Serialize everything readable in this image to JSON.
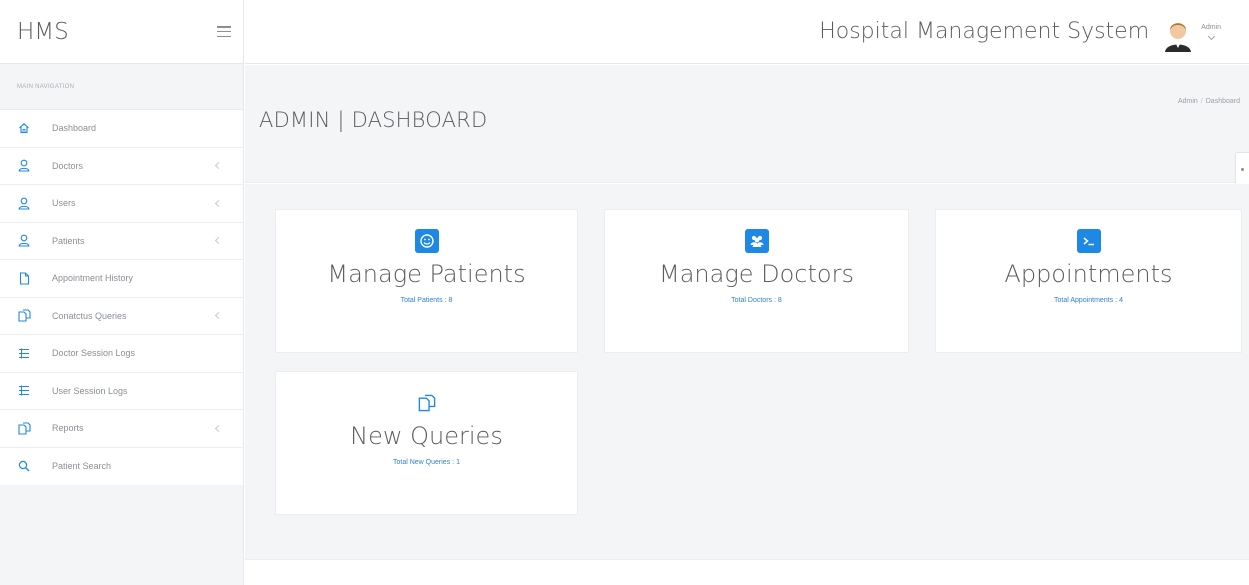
{
  "brand": "HMS",
  "app_title": "Hospital Management System",
  "user": {
    "name": "Admin"
  },
  "nav_header": "MAIN NAVIGATION",
  "nav": [
    {
      "label": "Dashboard",
      "icon": "home-icon",
      "chevron": false
    },
    {
      "label": "Doctors",
      "icon": "user-icon",
      "chevron": true
    },
    {
      "label": "Users",
      "icon": "user-icon",
      "chevron": true
    },
    {
      "label": "Patients",
      "icon": "user-icon",
      "chevron": true
    },
    {
      "label": "Appointment History",
      "icon": "file-icon",
      "chevron": false
    },
    {
      "label": "Conatctus Queries",
      "icon": "files-icon",
      "chevron": true
    },
    {
      "label": "Doctor Session Logs",
      "icon": "list-icon",
      "chevron": false
    },
    {
      "label": "User Session Logs",
      "icon": "list-icon",
      "chevron": false
    },
    {
      "label": "Reports",
      "icon": "files-icon",
      "chevron": true
    },
    {
      "label": "Patient Search",
      "icon": "search-icon",
      "chevron": false
    }
  ],
  "page_title": "ADMIN | DASHBOARD",
  "breadcrumb": {
    "parent": "Admin",
    "separator": "/",
    "current": "Dashboard"
  },
  "cards": [
    {
      "title": "Manage Patients",
      "link_label": "Total Patients :",
      "count": "8",
      "icon": "smile-icon"
    },
    {
      "title": "Manage Doctors",
      "link_label": "Total Doctors :",
      "count": "8",
      "icon": "users-icon"
    },
    {
      "title": "Appointments",
      "link_label": "Total Appointments :",
      "count": "4",
      "icon": "terminal-icon"
    },
    {
      "title": "New Queries",
      "link_label": "Total New Queries :",
      "count": "1",
      "icon": "files-icon"
    }
  ],
  "colors": {
    "accent": "#1e88e5",
    "link": "#2f7fd6",
    "sidebar_bg": "#f4f5f7"
  }
}
